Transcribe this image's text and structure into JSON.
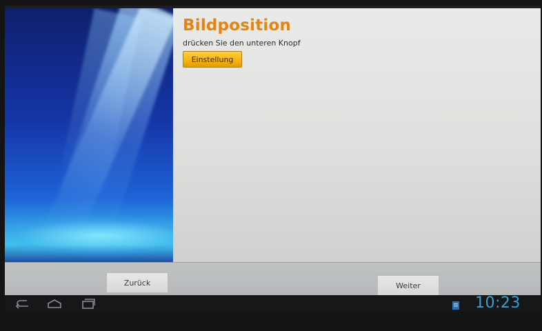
{
  "page": {
    "title": "Bildposition",
    "subtitle": "drücken Sie den unteren Knopf",
    "settings_button": "Einstellung"
  },
  "footer": {
    "back_label": "Zurück",
    "next_label": "Weiter"
  },
  "system_bar": {
    "time": "10:23",
    "icons": [
      "back-icon",
      "home-icon",
      "recent-apps-icon",
      "notification-icon"
    ]
  },
  "colors": {
    "title_orange": "#e8830e",
    "button_yellow": "#f6b414",
    "clock_blue": "#2fa3d8"
  }
}
